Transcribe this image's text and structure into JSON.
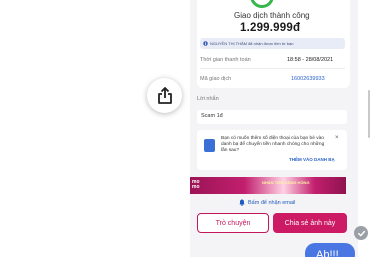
{
  "receipt": {
    "status": "Giao dịch thành công",
    "amount": "1.299.999đ",
    "notice": "NGUYỄN THỊ THẮM đã nhận được tiền từ bạn",
    "rows": [
      {
        "label": "Thời gian thanh toán",
        "value": "18:58 - 28/08/2021"
      },
      {
        "label": "Mã giao dịch",
        "value": "16002639933"
      }
    ]
  },
  "message": {
    "label": "Lời nhắn",
    "text": "Scam 1đ"
  },
  "suggestion": {
    "text": "Bạn có muốn thêm số điện thoại của bạn bè vào danh bạ để chuyển tiền nhanh chóng cho những lần sau?",
    "close": "×",
    "action": "THÊM VÀO DANH BẠ"
  },
  "banner": {
    "brand_top": "mo",
    "brand_bottom": "mo",
    "title": "NHẬN TIỀN SĂNG HỎNG"
  },
  "email_link": "Bấm để nhận email",
  "buttons": {
    "chat": "Trò chuyện",
    "share": "Chia sẻ ảnh này"
  },
  "chat_bubble": "Ab!!!",
  "icons": {
    "share": "share-icon",
    "check": "check-icon",
    "bell": "bell-icon",
    "contact": "contact-book-icon",
    "info": "info-icon"
  },
  "colors": {
    "accent": "#cc1a64",
    "success": "#36b64b",
    "link": "#2a63c9"
  }
}
